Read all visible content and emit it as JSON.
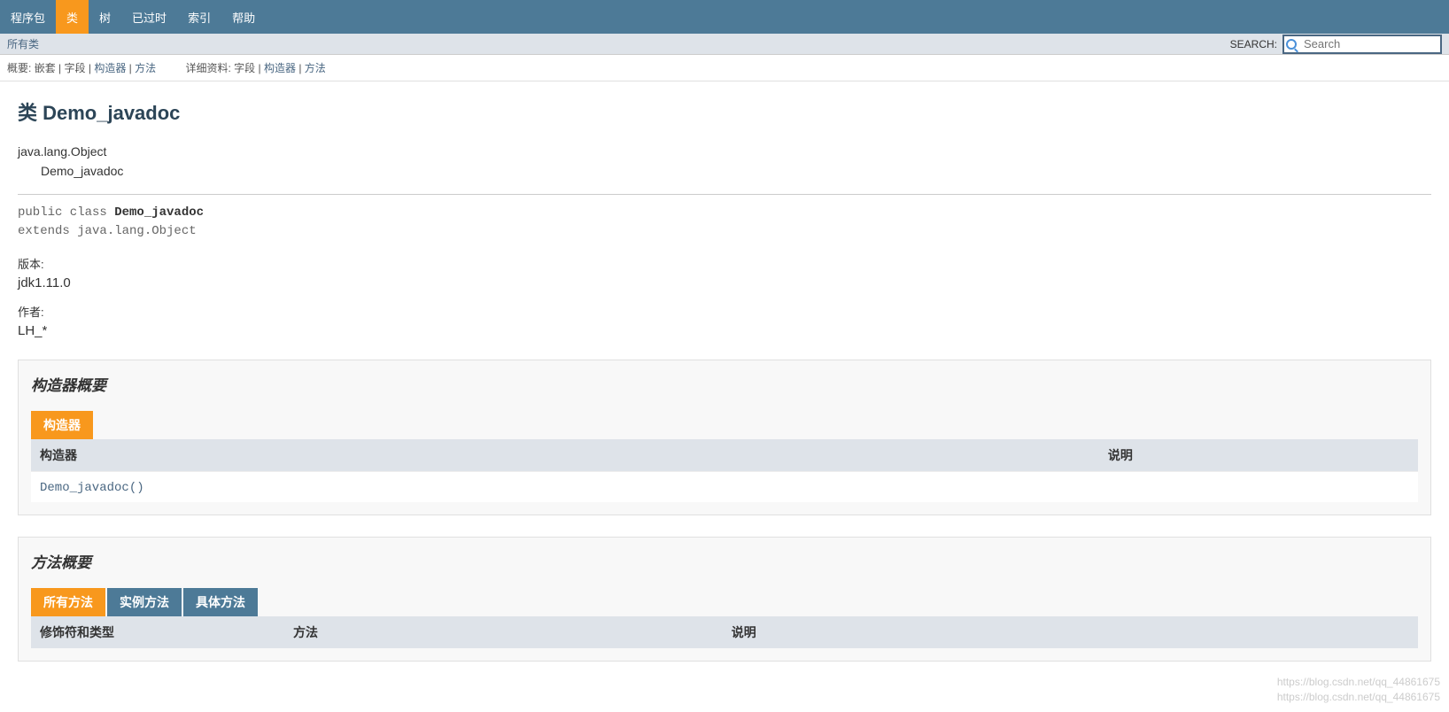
{
  "nav": {
    "items": [
      "程序包",
      "类",
      "树",
      "已过时",
      "索引",
      "帮助"
    ],
    "active_index": 1
  },
  "subbar": {
    "all_classes": "所有类",
    "search_label": "SEARCH:",
    "search_placeholder": "Search"
  },
  "meta": {
    "summary_label": "概要:",
    "summary_nested": "嵌套",
    "summary_field": "字段",
    "summary_constructor": "构造器",
    "summary_method": "方法",
    "detail_label": "详细资料:",
    "detail_field": "字段",
    "detail_constructor": "构造器",
    "detail_method": "方法",
    "sep": " | "
  },
  "class": {
    "title": "类 Demo_javadoc",
    "inheritance_parent": "java.lang.Object",
    "inheritance_self": "Demo_javadoc",
    "decl_prefix": "public class ",
    "decl_name": "Demo_javadoc",
    "decl_extends": "extends java.lang.Object",
    "version_label": "版本:",
    "version_value": "jdk1.11.0",
    "author_label": "作者:",
    "author_value": "LH_*"
  },
  "constructor_section": {
    "title": "构造器概要",
    "tab": "构造器",
    "col_name": "构造器",
    "col_desc": "说明",
    "row_name": "Demo_javadoc()"
  },
  "method_section": {
    "title": "方法概要",
    "tabs": [
      "所有方法",
      "实例方法",
      "具体方法"
    ],
    "active_tab_index": 0,
    "col_mod": "修饰符和类型",
    "col_name": "方法",
    "col_desc": "说明"
  },
  "watermark": {
    "line1": "https://blog.csdn.net/qq_44861675",
    "line2": "https://blog.csdn.net/qq_44861675"
  }
}
